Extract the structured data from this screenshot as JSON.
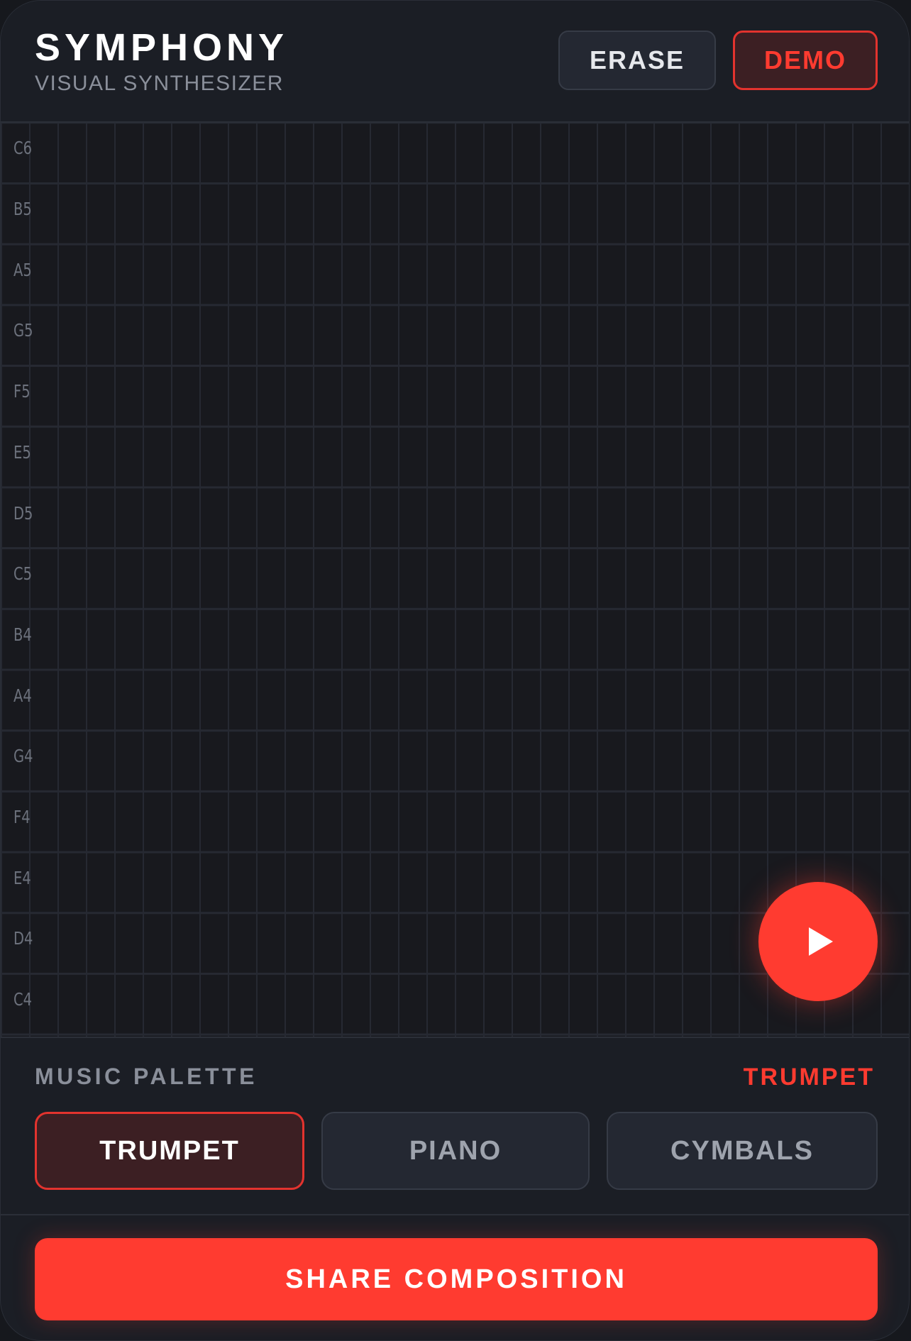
{
  "header": {
    "title": "SYMPHONY",
    "subtitle": "VISUAL SYNTHESIZER",
    "erase_label": "ERASE",
    "demo_label": "DEMO"
  },
  "grid": {
    "notes": [
      "C6",
      "B5",
      "A5",
      "G5",
      "F5",
      "E5",
      "D5",
      "C5",
      "B4",
      "A4",
      "G4",
      "F4",
      "E4",
      "D4",
      "C4"
    ]
  },
  "play": {
    "icon": "play-icon"
  },
  "palette": {
    "title": "MUSIC PALETTE",
    "selected": "TRUMPET",
    "instruments": [
      {
        "label": "TRUMPET",
        "active": true
      },
      {
        "label": "PIANO",
        "active": false
      },
      {
        "label": "CYMBALS",
        "active": false
      }
    ]
  },
  "share": {
    "label": "SHARE COMPOSITION"
  },
  "colors": {
    "accent": "#ff3b30",
    "background": "#1b1e25",
    "grid": "#18191e"
  }
}
